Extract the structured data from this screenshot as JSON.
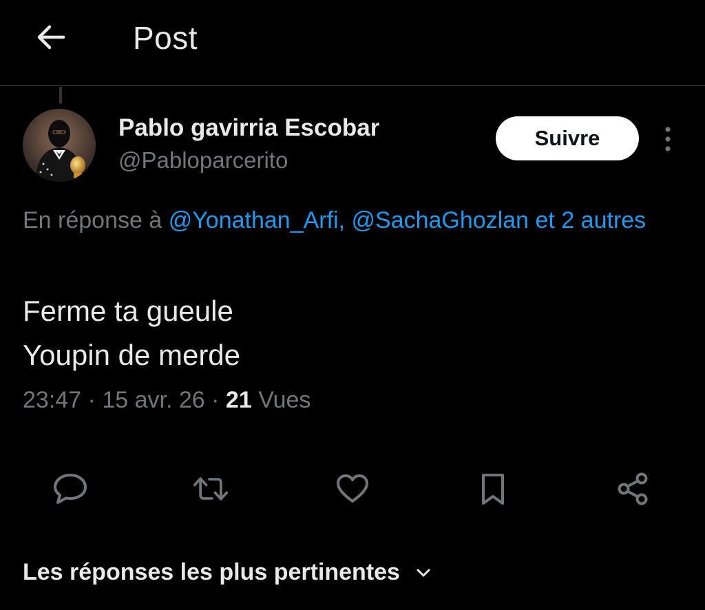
{
  "header": {
    "title": "Post",
    "back_icon": "arrow-left-icon"
  },
  "post": {
    "author": {
      "name": "Pablo gavirria Escobar",
      "handle": "@Pabloparcerito"
    },
    "follow_label": "Suivre",
    "more_icon": "more-vertical-icon",
    "reply_to": {
      "prefix": "En réponse à",
      "mention_1": "@Yonathan_Arfi,",
      "mention_2": "@SachaGhozlan",
      "others": "et 2 autres"
    },
    "text_lines": [
      "Ferme ta gueule",
      "Youpin de merde"
    ],
    "time": "23:47",
    "separator": "·",
    "date": "15 avr. 26",
    "views_count": "21",
    "views_label": "Vues",
    "actions": [
      {
        "name": "reply",
        "icon": "speech-bubble-icon"
      },
      {
        "name": "repost",
        "icon": "repost-icon"
      },
      {
        "name": "like",
        "icon": "heart-icon"
      },
      {
        "name": "bookmark",
        "icon": "bookmark-icon"
      },
      {
        "name": "share",
        "icon": "share-icon"
      }
    ]
  },
  "replies_sort": {
    "label": "Les réponses les plus pertinentes",
    "icon": "chevron-down-icon"
  },
  "colors": {
    "background": "#000000",
    "text_primary": "#e7e9ea",
    "text_secondary": "#71767b",
    "accent": "#1d9bf0",
    "divider": "#2f3336"
  }
}
